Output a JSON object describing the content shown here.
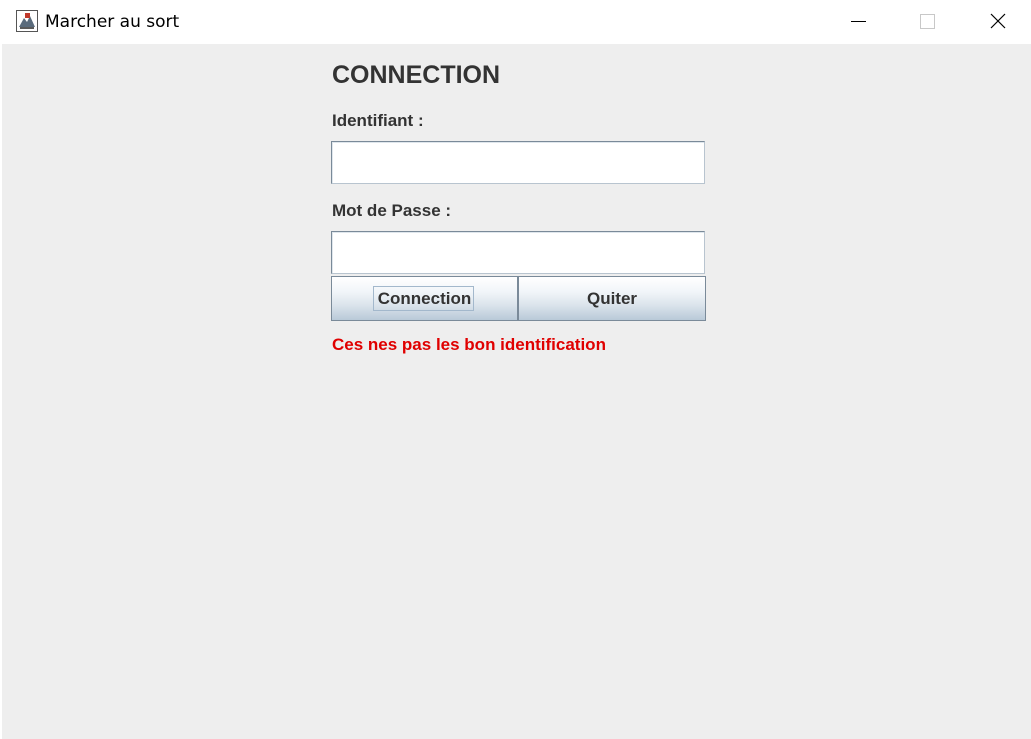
{
  "window": {
    "title": "Marcher au sort",
    "icon": "java-app-icon",
    "controls": [
      "minimize-icon",
      "maximize-icon",
      "close-icon"
    ]
  },
  "form": {
    "heading": "CONNECTION",
    "username_label": "Identifiant :",
    "username_value": "",
    "password_label": "Mot de Passe :",
    "password_value": "",
    "connect_label": "Connection",
    "quit_label": "Quiter",
    "error_message": "Ces nes pas les bon identification"
  },
  "colors": {
    "background": "#eeeeee",
    "text": "#333333",
    "error": "#e00000"
  }
}
